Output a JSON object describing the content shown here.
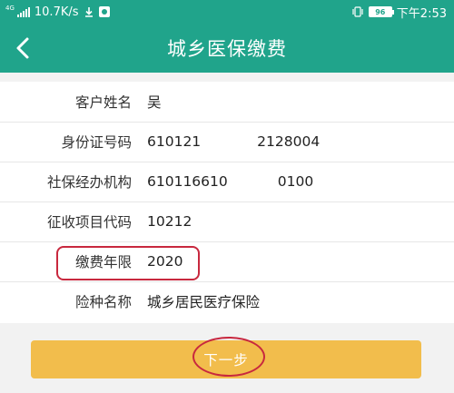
{
  "status_bar": {
    "network_tag": "4G",
    "speed": "10.7K/s",
    "battery": "96",
    "time": "下午2:53"
  },
  "header": {
    "title": "城乡医保缴费",
    "back_icon": "chevron-left-icon"
  },
  "form": {
    "rows": [
      {
        "label": "客户姓名",
        "value": "吴"
      },
      {
        "label": "身份证号码",
        "value_a": "610121",
        "value_b": "2128004"
      },
      {
        "label": "社保经办机构",
        "value_a": "610116610",
        "value_b": "0100"
      },
      {
        "label": "征收项目代码",
        "value": "10212"
      },
      {
        "label": "缴费年限",
        "value": "2020"
      },
      {
        "label": "险种名称",
        "value": "城乡居民医疗保险"
      }
    ]
  },
  "actions": {
    "next_label": "下一步"
  },
  "colors": {
    "primary": "#20a48b",
    "button": "#f2bd4c",
    "annotation": "#c8283e",
    "background": "#f2f2f2"
  }
}
